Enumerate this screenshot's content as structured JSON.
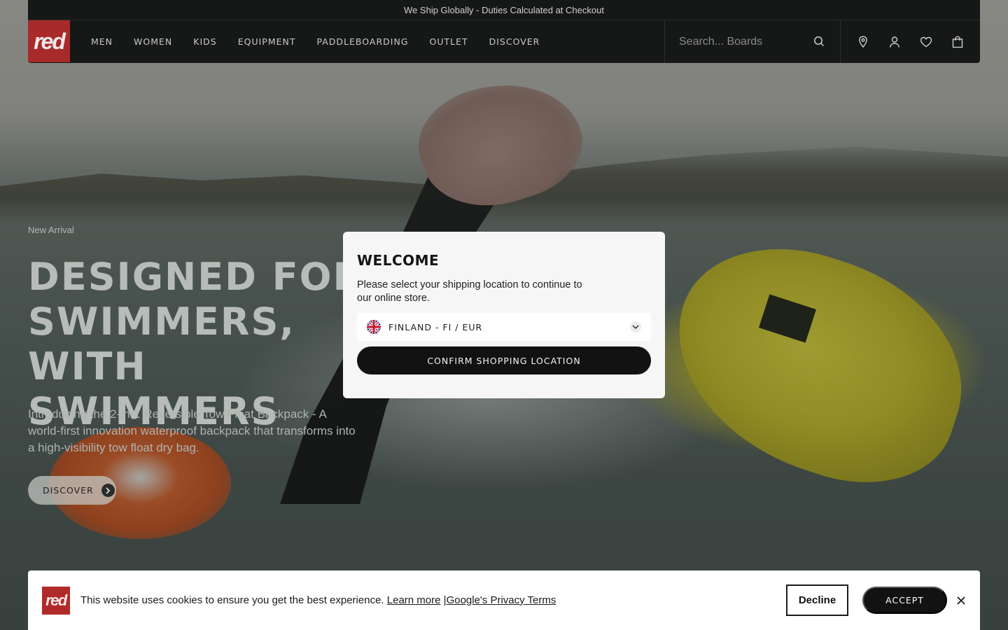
{
  "announcement": "We Ship Globally - Duties Calculated at Checkout",
  "logo": {
    "text": "red"
  },
  "nav": {
    "items": [
      "MEN",
      "WOMEN",
      "KIDS",
      "EQUIPMENT",
      "PADDLEBOARDING",
      "OUTLET",
      "DISCOVER"
    ]
  },
  "search": {
    "placeholder": "Search... Boards"
  },
  "header_icons": [
    "location-pin-icon",
    "account-icon",
    "wishlist-heart-icon",
    "cart-bag-icon"
  ],
  "hero": {
    "eyebrow": "New Arrival",
    "headline": "DESIGNED FOR SWIMMERS, WITH SWIMMERS",
    "subtext": "Introducing the 2-in-1 Reversible Tow Float Backpack - A world-first innovation waterproof backpack that transforms into a high-visibility tow float dry bag.",
    "cta_label": "DISCOVER"
  },
  "modal": {
    "title": "WELCOME",
    "text": "Please select your shipping location to continue to our online store.",
    "selected_country": "FINLAND - FI / EUR",
    "confirm_label": "CONFIRM SHOPPING LOCATION"
  },
  "cookie": {
    "logo_text": "red",
    "message": "This website uses cookies to ensure you get the best experience.",
    "learn_more": "Learn more",
    "separator": "|",
    "privacy_terms": "Google's Privacy Terms",
    "decline_label": "Decline",
    "accept_label": "ACCEPT"
  },
  "colors": {
    "brand_red": "#a82a2a",
    "header_bg": "#161717",
    "button_dark": "#121212"
  }
}
